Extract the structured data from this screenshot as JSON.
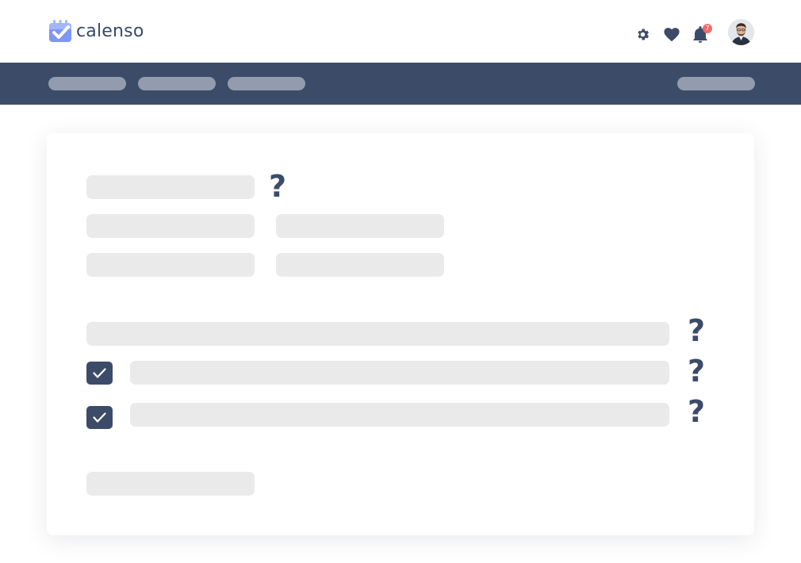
{
  "app": {
    "brand": "calenso",
    "brand_color": "#3a4a66",
    "logo_icon": "calendar-check-icon",
    "logo_colors": [
      "#8fa6f7",
      "#5b79ee"
    ]
  },
  "header": {
    "icons": [
      "gear-icon",
      "heart-icon",
      "bell-icon"
    ],
    "notification_count": "7",
    "badge_color": "#ef6b68",
    "avatar": "user-avatar"
  },
  "nav": {
    "background": "#3c4c68",
    "items": [
      "",
      "",
      ""
    ],
    "right_item": ""
  },
  "form": {
    "help_glyph": "?",
    "checkboxes": [
      {
        "checked": true
      },
      {
        "checked": true
      }
    ]
  }
}
